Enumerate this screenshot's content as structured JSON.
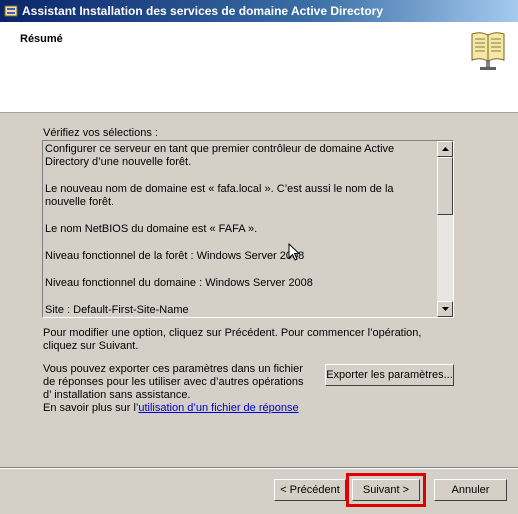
{
  "window": {
    "title": "Assistant Installation des services de domaine Active Directory"
  },
  "header": {
    "title": "Résumé",
    "icon": "book-icon"
  },
  "main": {
    "verify_label": "Vérifiez vos sélections :",
    "summary_lines": [
      "Configurer ce serveur en tant que premier contrôleur de domaine Active Directory d’une nouvelle forêt.",
      "Le nouveau nom de domaine est « fafa.local ». C’est aussi le nom de la nouvelle forêt.",
      "Le nom NetBIOS du domaine est « FAFA ».",
      "Niveau fonctionnel de la forêt : Windows Server 2008",
      "Niveau fonctionnel du domaine : Windows Server 2008",
      "Site : Default-First-Site-Name"
    ],
    "modify_text": "Pour modifier une option, cliquez sur Précédent. Pour commencer l’opération, cliquez sur Suivant.",
    "export_text": "Vous pouvez exporter ces paramètres dans un fichier de réponses pour les utiliser avec d’autres opérations d’ installation sans assistance.",
    "export_button": "Exporter les paramètres...",
    "learn_more_prefix": "En savoir plus sur l’",
    "learn_more_link": "utilisation d’un fichier de réponse"
  },
  "footer": {
    "prev_button": "< Précédent",
    "next_button": "Suivant >",
    "cancel_button": "Annuler"
  },
  "colors": {
    "highlight": "#e00000",
    "link": "#0000cc",
    "titlebar": "#0a246a"
  }
}
